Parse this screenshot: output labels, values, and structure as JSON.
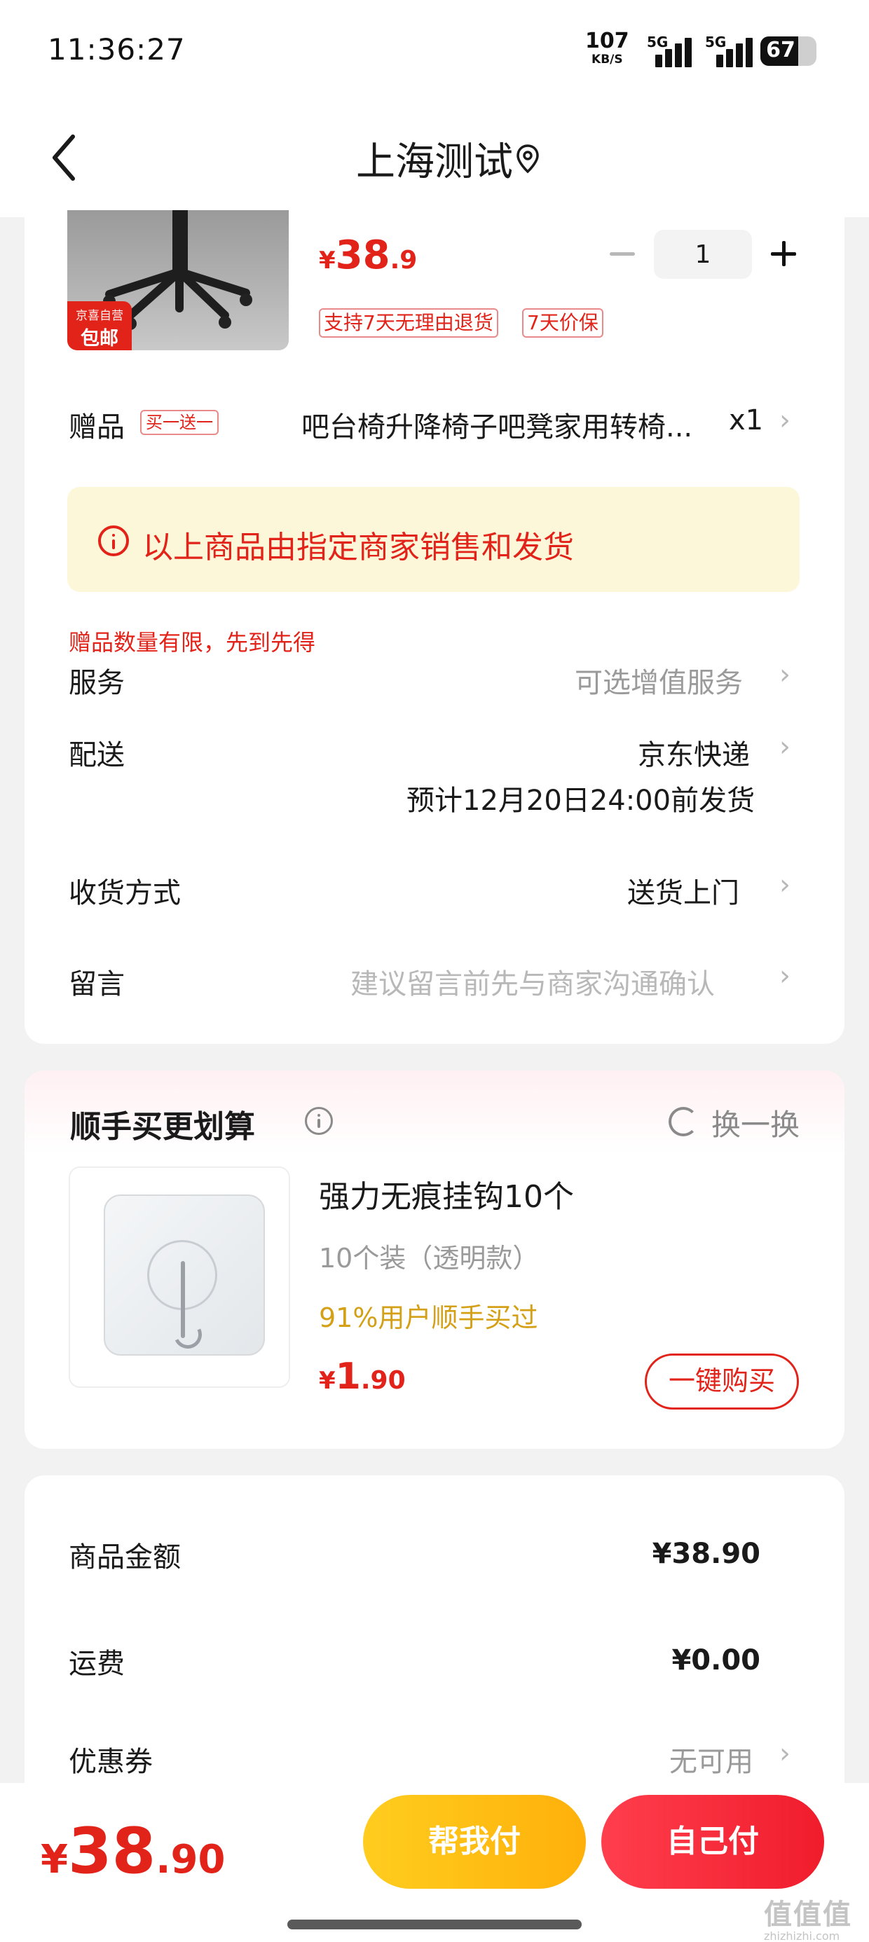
{
  "status_bar": {
    "time": "11:36:27",
    "net_speed": "107",
    "net_unit": "KB/S",
    "signal1": "5G",
    "signal2": "5G",
    "battery": "67"
  },
  "nav": {
    "title": "上海测试"
  },
  "product": {
    "badge_top": "京喜自营",
    "badge_main": "包邮",
    "price_currency": "¥",
    "price_int": "38",
    "price_dec": ".9",
    "quantity": "1",
    "tags": [
      "支持7天无理由退货",
      "7天价保"
    ]
  },
  "gift": {
    "label": "赠品",
    "tag": "买一送一",
    "name": "吧台椅升降椅子吧凳家用转椅...",
    "qty": "x1"
  },
  "notice": "以上商品由指定商家销售和发货",
  "gift_warning": "赠品数量有限，先到先得",
  "rows": {
    "service": {
      "label": "服务",
      "value": "可选增值服务"
    },
    "delivery": {
      "label": "配送",
      "value": "京东快递",
      "sub": "预计12月20日24:00前发货"
    },
    "receive": {
      "label": "收货方式",
      "value": "送货上门"
    },
    "message": {
      "label": "留言",
      "placeholder": "建议留言前先与商家沟通确认"
    }
  },
  "recommend": {
    "title": "顺手买更划算",
    "refresh": "换一换",
    "item": {
      "name": "强力无痕挂钩10个",
      "spec": "10个装（透明款）",
      "stat": "91%用户顺手买过",
      "price_currency": "¥",
      "price_int": "1",
      "price_dec": ".90",
      "button": "一键购买"
    }
  },
  "summary": {
    "goods": {
      "label": "商品金额",
      "value": "¥38.90"
    },
    "shipping": {
      "label": "运费",
      "value": "¥0.00"
    },
    "coupon": {
      "label": "优惠券",
      "value": "无可用"
    }
  },
  "bottom": {
    "total_currency": "¥",
    "total_int": "38",
    "total_dec": ".90",
    "help_pay": "帮我付",
    "self_pay": "自己付"
  },
  "watermark": {
    "main": "值值值",
    "sub": "zhizhizhi.com"
  },
  "colors": {
    "accent_red": "#e2231a",
    "gold": "#d4a017",
    "notice_bg": "#fdf7d9",
    "help_pay": "#ffb00a",
    "self_pay": "#f01c2c"
  }
}
